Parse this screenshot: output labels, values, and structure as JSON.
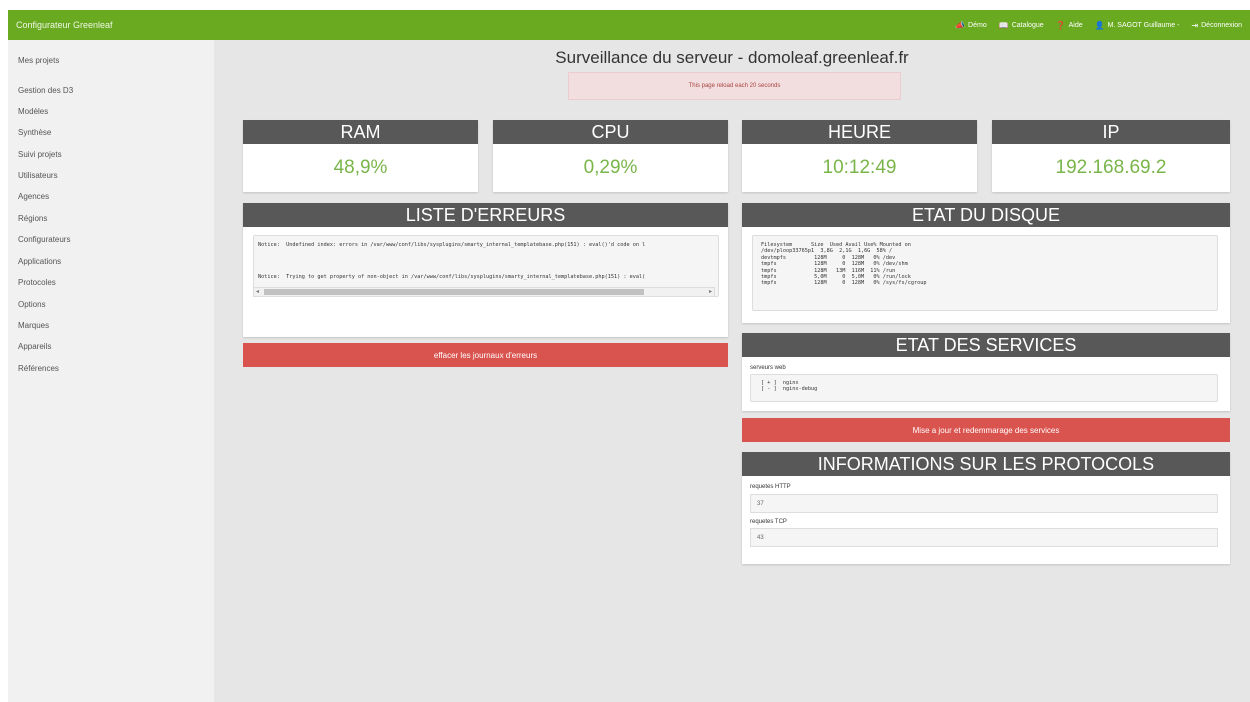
{
  "app": {
    "title": "Configurateur Greenleaf"
  },
  "topnav": {
    "items": [
      {
        "icon": "megaphone-icon",
        "glyph": "📣",
        "label": "Démo"
      },
      {
        "icon": "book-icon",
        "glyph": "📖",
        "label": "Catalogue"
      },
      {
        "icon": "help-icon",
        "glyph": "❓",
        "label": "Aide"
      },
      {
        "icon": "user-icon",
        "glyph": "👤",
        "label": "M. SAGOT Guillaume -"
      },
      {
        "icon": "logout-icon",
        "glyph": "⇥",
        "label": "Déconnexion"
      }
    ]
  },
  "sidebar": {
    "items": [
      "Mes projets",
      "Gestion des D3",
      "Modèles",
      "Synthèse",
      "Suivi projets",
      "Utilisateurs",
      "Agences",
      "Régions",
      "Configurateurs",
      "Applications",
      "Protocoles",
      "Options",
      "Marques",
      "Appareils",
      "Références"
    ]
  },
  "page": {
    "title": "Surveillance du serveur - domoleaf.greenleaf.fr",
    "reload_notice": "This page reload each 20 seconds"
  },
  "stats": {
    "ram": {
      "title": "RAM",
      "value": "48,9%"
    },
    "cpu": {
      "title": "CPU",
      "value": "0,29%"
    },
    "heure": {
      "title": "HEURE",
      "value": "10:12:49"
    },
    "ip": {
      "title": "IP",
      "value": "192.168.69.2"
    }
  },
  "errors": {
    "title": "LISTE D'ERREURS",
    "log": "Notice:  Undefined index: errors in /var/www/conf/libs/sysplugins/smarty_internal_templatebase.php(151) : eval()'d code on l\n\n\n\n\nNotice:  Trying to get property of non-object in /var/www/conf/libs/sysplugins/smarty_internal_templatebase.php(151) : eval(",
    "clear_button": "effacer les journaux d'erreurs"
  },
  "disk": {
    "title": "ETAT DU DISQUE",
    "output": "Filesystem      Size  Used Avail Use% Mounted on\n/dev/ploop33765p1  3,8G  2,1G  1,6G  58% /\ndevtmpfs         128M     0  128M   0% /dev\ntmpfs            128M     0  128M   0% /dev/shm\ntmpfs            128M   13M  116M  11% /run\ntmpfs            5,0M     0  5,0M   0% /run/lock\ntmpfs            128M     0  128M   0% /sys/fs/cgroup"
  },
  "services": {
    "title": "ETAT DES SERVICES",
    "group_label": "serveurs web",
    "output": "[ + ]  nginx\n[ - ]  nginx-debug",
    "restart_button": "Mise a jour et redemmarage des services"
  },
  "protocols": {
    "title": "INFORMATIONS SUR LES PROTOCOLS",
    "http_label": "requetes HTTP",
    "http_value": "37",
    "tcp_label": "requetes TCP",
    "tcp_value": "43"
  },
  "colors": {
    "brand_green": "#6aaa21",
    "panel_header": "#585858",
    "stat_green": "#7ab54a",
    "danger_red": "#d9534f",
    "alert_bg": "#f2dede"
  }
}
